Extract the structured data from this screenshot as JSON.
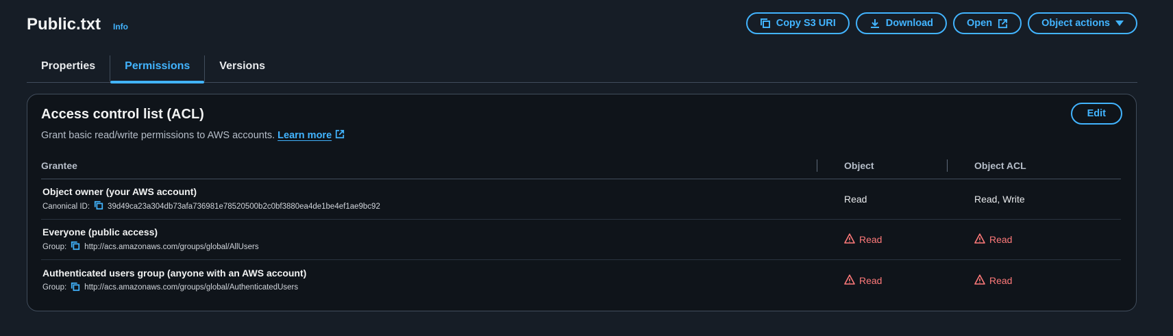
{
  "header": {
    "title": "Public.txt",
    "info": "Info",
    "buttons": {
      "copy_uri": "Copy S3 URI",
      "download": "Download",
      "open": "Open",
      "object_actions": "Object actions"
    }
  },
  "tabs": [
    "Properties",
    "Permissions",
    "Versions"
  ],
  "active_tab": "Permissions",
  "acl": {
    "title": "Access control list (ACL)",
    "description": "Grant basic read/write permissions to AWS accounts.",
    "learn_more": "Learn more",
    "edit": "Edit",
    "columns": [
      "Grantee",
      "Object",
      "Object ACL"
    ],
    "rows": [
      {
        "name": "Object owner (your AWS account)",
        "sub_label": "Canonical ID:",
        "sub_value": "39d49ca23a304db73afa736981e78520500b2c0bf3880ea4de1be4ef1ae9bc92",
        "object": "Read",
        "object_acl": "Read, Write",
        "warning": false
      },
      {
        "name": "Everyone (public access)",
        "sub_label": "Group:",
        "sub_value": "http://acs.amazonaws.com/groups/global/AllUsers",
        "object": "Read",
        "object_acl": "Read",
        "warning": true
      },
      {
        "name": "Authenticated users group (anyone with an AWS account)",
        "sub_label": "Group:",
        "sub_value": "http://acs.amazonaws.com/groups/global/AuthenticatedUsers",
        "object": "Read",
        "object_acl": "Read",
        "warning": true
      }
    ]
  },
  "colors": {
    "accent": "#42b4ff",
    "warning": "#ff7a7a",
    "background": "#161d26"
  }
}
